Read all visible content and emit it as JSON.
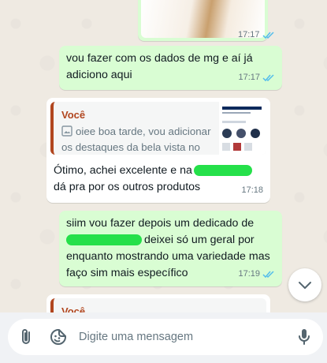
{
  "messages": [
    {
      "time": "17:17"
    },
    {
      "text": "vou fazer com os dados de mg e aí já adiciono aqui",
      "time": "17:17"
    },
    {
      "quote_author": "Você",
      "quote_text": "oiee boa tarde, vou adicionar os destaques da bela vista no ...",
      "text_before": "Ótimo, achei excelente e na",
      "text_after": "dá pra por os outros produtos",
      "time": "17:18"
    },
    {
      "line1": "siim vou fazer depois um dedicado de",
      "line2_after": "deixei só um geral por",
      "line3": "enquanto mostrando uma variedade mas",
      "line4": "faço sim mais específico",
      "time": "17:19"
    },
    {
      "quote_author": "Você"
    }
  ],
  "composer": {
    "placeholder": "Digite uma mensagem"
  },
  "icons": {
    "attach": "paperclip-icon",
    "sticker": "sticker-icon",
    "mic": "microphone-icon",
    "scroll": "chevron-down-icon",
    "read": "double-check-icon",
    "image": "image-icon"
  },
  "colors": {
    "outgoing": "#d9fdd3",
    "incoming": "#ffffff",
    "background": "#efeae2",
    "read_ticks": "#53bdeb",
    "quote_accent": "#b1461f",
    "redaction": "#25e04a"
  }
}
